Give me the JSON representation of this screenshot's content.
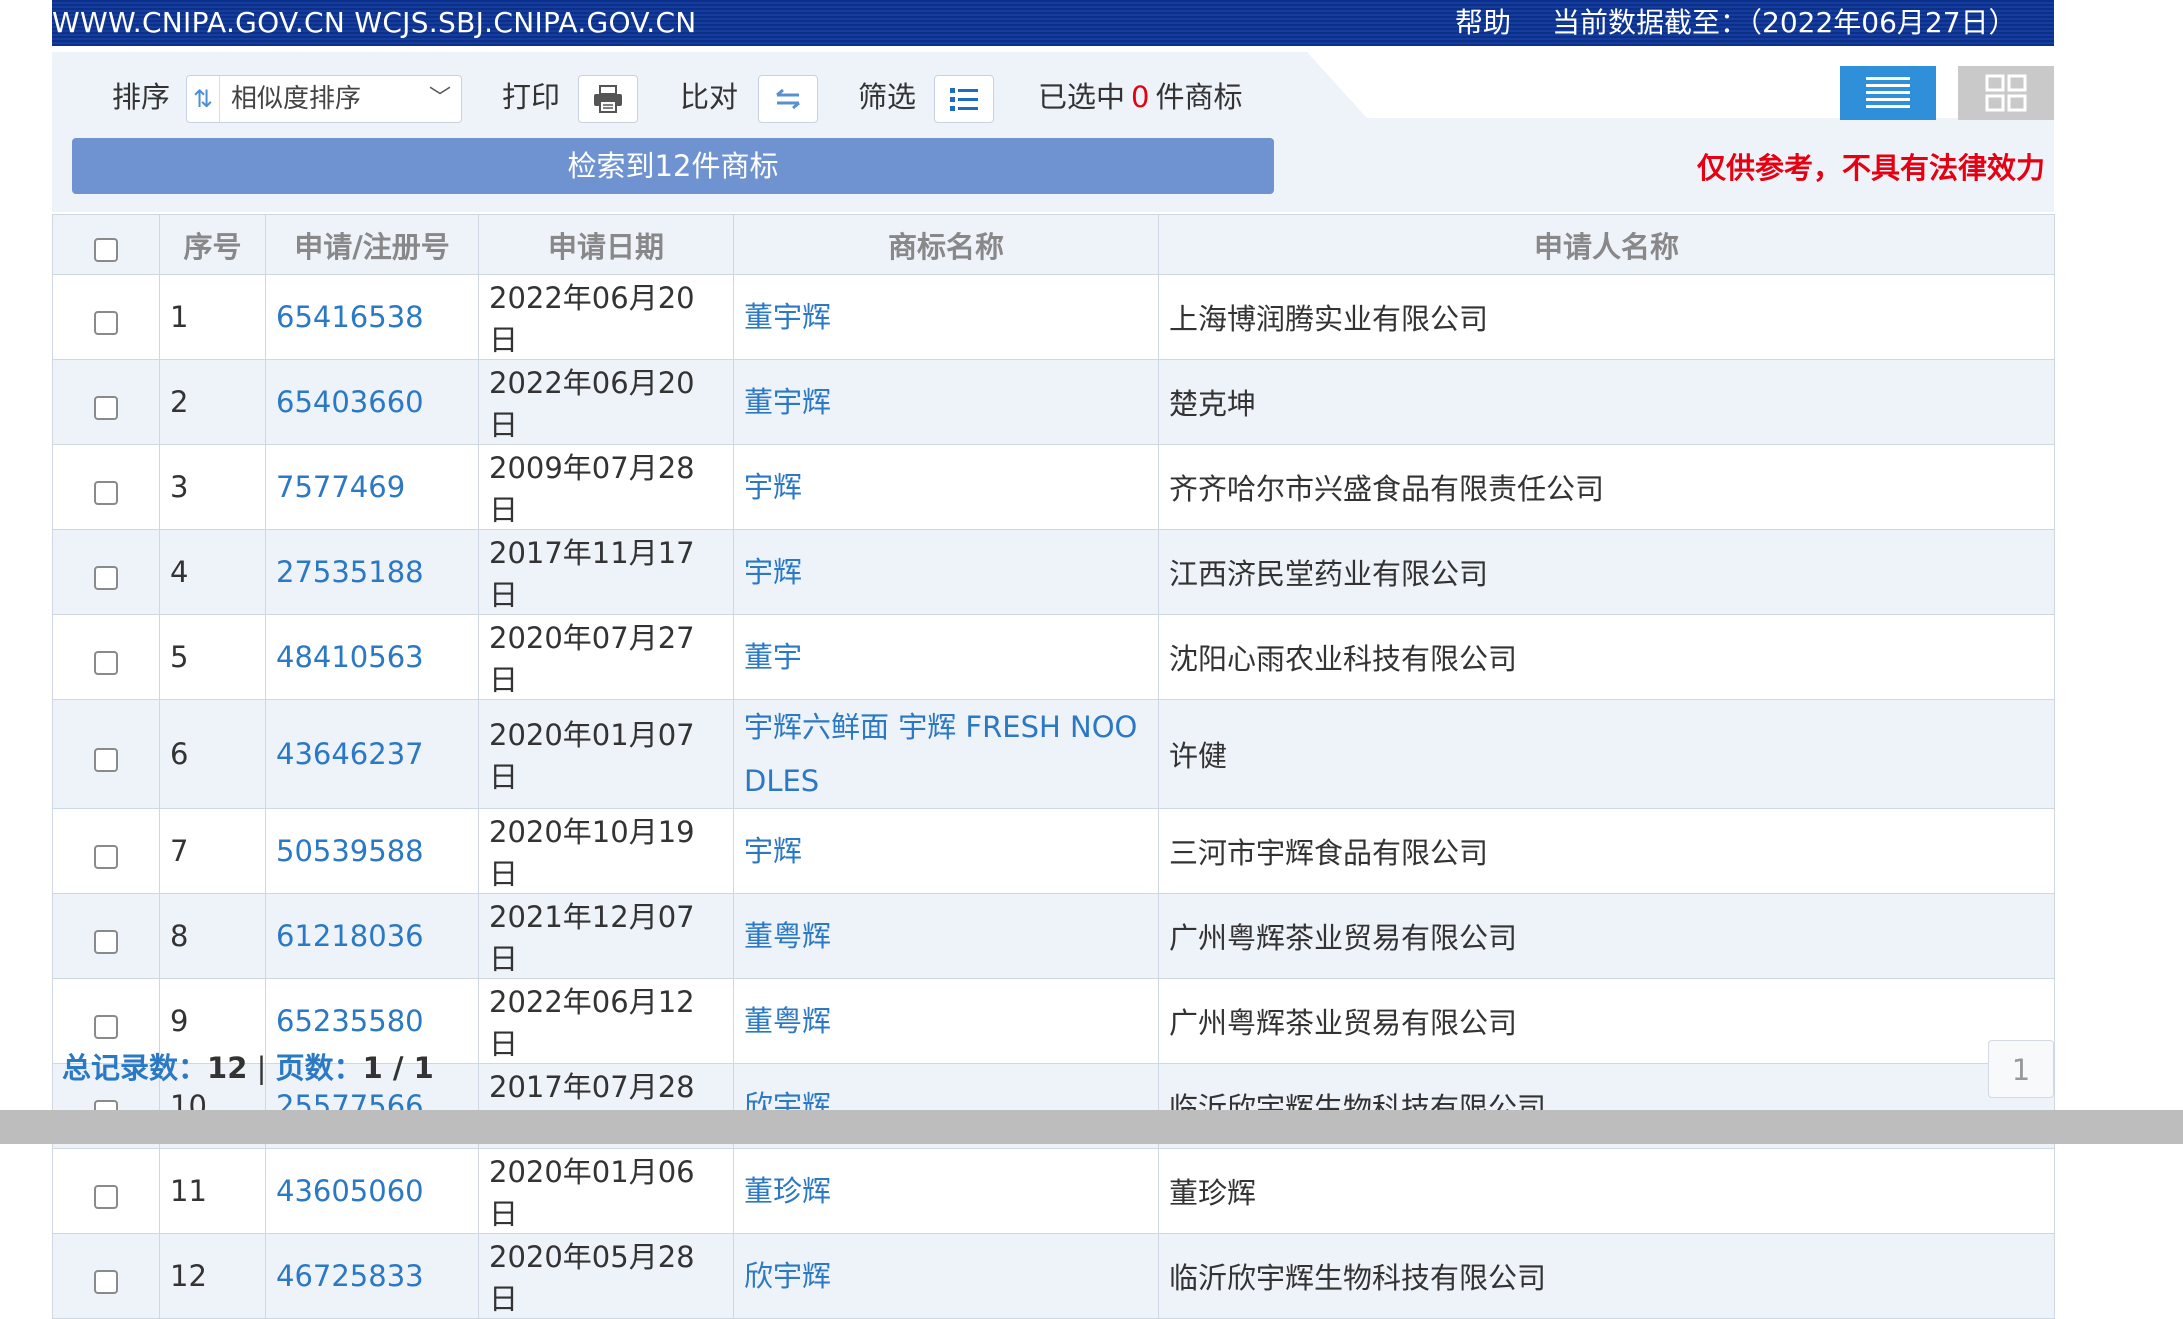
{
  "header": {
    "sites": "WWW.CNIPA.GOV.CN WCJS.SBJ.CNIPA.GOV.CN",
    "help": "帮助",
    "data_cutoff": "当前数据截至：（2022年06月27日）"
  },
  "toolbar": {
    "sort_label": "排序",
    "sort_value": "相似度排序",
    "print_label": "打印",
    "compare_label": "比对",
    "filter_label": "筛选",
    "selected_prefix": "已选中",
    "selected_count": "0",
    "selected_suffix": "件商标",
    "result_text": "检索到12件商标",
    "disclaimer": "仅供参考，不具有法律效力"
  },
  "table": {
    "headers": [
      "序号",
      "申请/注册号",
      "申请日期",
      "商标名称",
      "申请人名称"
    ],
    "rows": [
      {
        "no": "1",
        "reg": "65416538",
        "date": "2022年06月20日",
        "name": "董宇辉",
        "applicant": "上海博润腾实业有限公司"
      },
      {
        "no": "2",
        "reg": "65403660",
        "date": "2022年06月20日",
        "name": "董宇辉",
        "applicant": "楚克坤"
      },
      {
        "no": "3",
        "reg": "7577469",
        "date": "2009年07月28日",
        "name": "宇辉",
        "applicant": "齐齐哈尔市兴盛食品有限责任公司"
      },
      {
        "no": "4",
        "reg": "27535188",
        "date": "2017年11月17日",
        "name": "宇辉",
        "applicant": "江西济民堂药业有限公司"
      },
      {
        "no": "5",
        "reg": "48410563",
        "date": "2020年07月27日",
        "name": "董宇",
        "applicant": "沈阳心雨农业科技有限公司"
      },
      {
        "no": "6",
        "reg": "43646237",
        "date": "2020年01月07日",
        "name": "宇辉六鲜面 宇辉 FRESH NOODLES",
        "applicant": "许健"
      },
      {
        "no": "7",
        "reg": "50539588",
        "date": "2020年10月19日",
        "name": "宇辉",
        "applicant": "三河市宇辉食品有限公司"
      },
      {
        "no": "8",
        "reg": "61218036",
        "date": "2021年12月07日",
        "name": "董粤辉",
        "applicant": "广州粤辉茶业贸易有限公司"
      },
      {
        "no": "9",
        "reg": "65235580",
        "date": "2022年06月12日",
        "name": "董粤辉",
        "applicant": "广州粤辉茶业贸易有限公司"
      },
      {
        "no": "10",
        "reg": "25577566",
        "date": "2017年07月28日",
        "name": "欣宇辉",
        "applicant": "临沂欣宇辉生物科技有限公司"
      },
      {
        "no": "11",
        "reg": "43605060",
        "date": "2020年01月06日",
        "name": "董珍辉",
        "applicant": "董珍辉"
      },
      {
        "no": "12",
        "reg": "46725833",
        "date": "2020年05月28日",
        "name": "欣宇辉",
        "applicant": "临沂欣宇辉生物科技有限公司"
      }
    ]
  },
  "footer": {
    "total_label": "总记录数：",
    "total_value": "12",
    "separator": "|",
    "pages_label": "页数：",
    "pages_value": "1 / 1",
    "page_button": "1"
  },
  "colors": {
    "header_bg": "#0b2f8a",
    "accent_blue": "#2b78c5",
    "result_bar": "#6f93d1",
    "warning_red": "#e60012",
    "active_view": "#2f8fd8"
  },
  "icons": {
    "sort": "sort-arrows-icon",
    "print": "printer-icon",
    "compare": "swap-arrows-icon",
    "filter": "list-icon",
    "list_view": "list-view-icon",
    "grid_view": "grid-view-icon"
  }
}
